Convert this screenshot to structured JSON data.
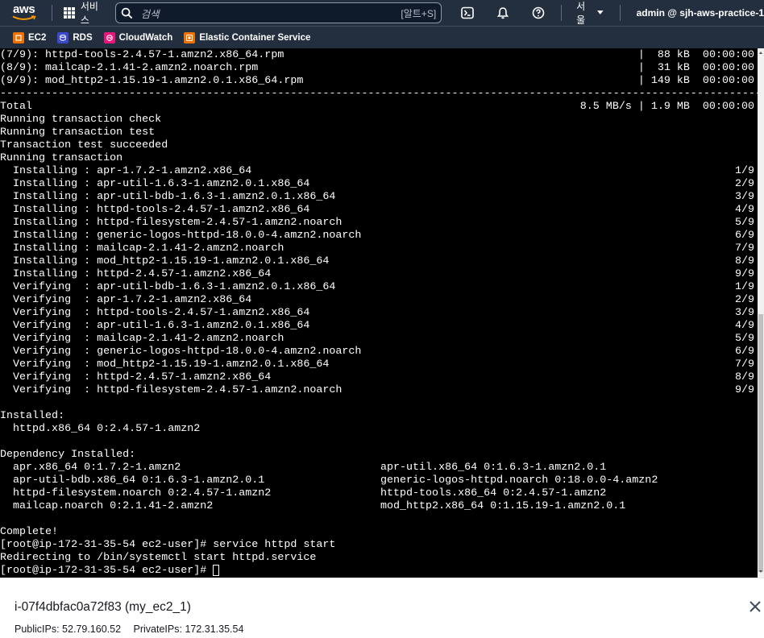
{
  "topnav": {
    "logo": "aws",
    "services_label": "서비스",
    "search_placeholder": "검색",
    "search_shortcut": "[알트+S]",
    "region": "서울",
    "account": "admin @ sjh-aws-practice-1"
  },
  "favorites": [
    {
      "label": "EC2",
      "color": "#ed7100"
    },
    {
      "label": "RDS",
      "color": "#3b48cc"
    },
    {
      "label": "CloudWatch",
      "color": "#e7157b"
    },
    {
      "label": "Elastic Container Service",
      "color": "#ed7100"
    }
  ],
  "terminal": {
    "lines": [
      {
        "text": "(7/9): httpd-tools-2.4.57-1.amzn2.x86_64.rpm",
        "right": "|  88 kB  00:00:00"
      },
      {
        "text": "(8/9): mailcap-2.1.41-2.amzn2.noarch.rpm",
        "right": "|  31 kB  00:00:00"
      },
      {
        "text": "(9/9): mod_http2-1.15.19-1.amzn2.0.1.x86_64.rpm",
        "right": "| 149 kB  00:00:00"
      },
      {
        "text": "----------------------------------------------------------------------------------------------------------------------",
        "right": ""
      },
      {
        "text": "Total",
        "right": "8.5 MB/s | 1.9 MB  00:00:00"
      },
      {
        "text": "Running transaction check",
        "right": ""
      },
      {
        "text": "Running transaction test",
        "right": ""
      },
      {
        "text": "Transaction test succeeded",
        "right": ""
      },
      {
        "text": "Running transaction",
        "right": ""
      },
      {
        "text": "  Installing : apr-1.7.2-1.amzn2.x86_64",
        "right": "1/9"
      },
      {
        "text": "  Installing : apr-util-1.6.3-1.amzn2.0.1.x86_64",
        "right": "2/9"
      },
      {
        "text": "  Installing : apr-util-bdb-1.6.3-1.amzn2.0.1.x86_64",
        "right": "3/9"
      },
      {
        "text": "  Installing : httpd-tools-2.4.57-1.amzn2.x86_64",
        "right": "4/9"
      },
      {
        "text": "  Installing : httpd-filesystem-2.4.57-1.amzn2.noarch",
        "right": "5/9"
      },
      {
        "text": "  Installing : generic-logos-httpd-18.0.0-4.amzn2.noarch",
        "right": "6/9"
      },
      {
        "text": "  Installing : mailcap-2.1.41-2.amzn2.noarch",
        "right": "7/9"
      },
      {
        "text": "  Installing : mod_http2-1.15.19-1.amzn2.0.1.x86_64",
        "right": "8/9"
      },
      {
        "text": "  Installing : httpd-2.4.57-1.amzn2.x86_64",
        "right": "9/9"
      },
      {
        "text": "  Verifying  : apr-util-bdb-1.6.3-1.amzn2.0.1.x86_64",
        "right": "1/9"
      },
      {
        "text": "  Verifying  : apr-1.7.2-1.amzn2.x86_64",
        "right": "2/9"
      },
      {
        "text": "  Verifying  : httpd-tools-2.4.57-1.amzn2.x86_64",
        "right": "3/9"
      },
      {
        "text": "  Verifying  : apr-util-1.6.3-1.amzn2.0.1.x86_64",
        "right": "4/9"
      },
      {
        "text": "  Verifying  : mailcap-2.1.41-2.amzn2.noarch",
        "right": "5/9"
      },
      {
        "text": "  Verifying  : generic-logos-httpd-18.0.0-4.amzn2.noarch",
        "right": "6/9"
      },
      {
        "text": "  Verifying  : mod_http2-1.15.19-1.amzn2.0.1.x86_64",
        "right": "7/9"
      },
      {
        "text": "  Verifying  : httpd-2.4.57-1.amzn2.x86_64",
        "right": "8/9"
      },
      {
        "text": "  Verifying  : httpd-filesystem-2.4.57-1.amzn2.noarch",
        "right": "9/9"
      },
      {
        "text": "",
        "right": ""
      },
      {
        "text": "Installed:",
        "right": ""
      },
      {
        "text": "  httpd.x86_64 0:2.4.57-1.amzn2",
        "right": ""
      },
      {
        "text": "",
        "right": ""
      },
      {
        "text": "Dependency Installed:",
        "right": ""
      },
      {
        "text": "  apr.x86_64 0:1.7.2-1.amzn2",
        "col2": "apr-util.x86_64 0:1.6.3-1.amzn2.0.1"
      },
      {
        "text": "  apr-util-bdb.x86_64 0:1.6.3-1.amzn2.0.1",
        "col2": "generic-logos-httpd.noarch 0:18.0.0-4.amzn2"
      },
      {
        "text": "  httpd-filesystem.noarch 0:2.4.57-1.amzn2",
        "col2": "httpd-tools.x86_64 0:2.4.57-1.amzn2"
      },
      {
        "text": "  mailcap.noarch 0:2.1.41-2.amzn2",
        "col2": "mod_http2.x86_64 0:1.15.19-1.amzn2.0.1"
      },
      {
        "text": "",
        "right": ""
      },
      {
        "text": "Complete!",
        "right": ""
      },
      {
        "text": "[root@ip-172-31-35-54 ec2-user]# service httpd start",
        "right": ""
      },
      {
        "text": "Redirecting to /bin/systemctl start httpd.service",
        "right": ""
      },
      {
        "text": "[root@ip-172-31-35-54 ec2-user]# ",
        "right": "",
        "cursor": true
      }
    ]
  },
  "footer": {
    "instance": "i-07f4dbfac0a72f83 (my_ec2_1)",
    "public_ips": "PublicIPs: 52.79.160.52",
    "private_ips": "PrivateIPs: 172.31.35.54"
  }
}
